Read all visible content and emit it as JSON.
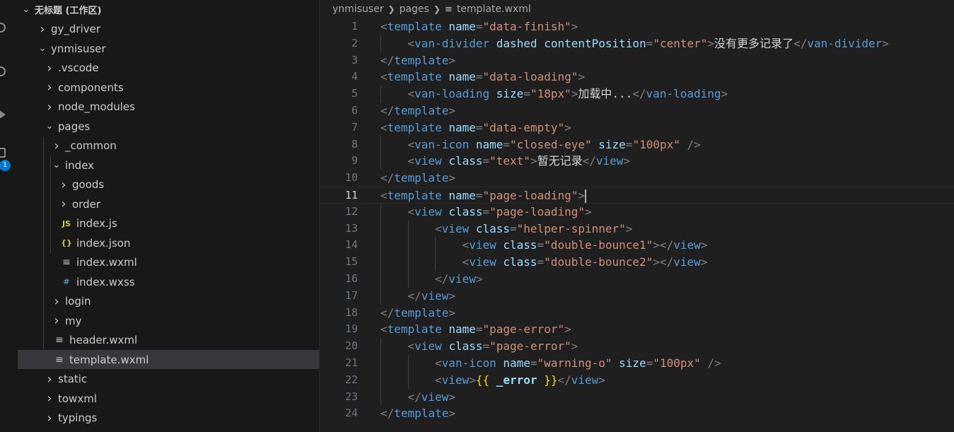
{
  "explorer": {
    "workspace_title": "无标题 (工作区)",
    "items": [
      {
        "label": "gy_driver",
        "kind": "folder",
        "expanded": false,
        "depth": 1
      },
      {
        "label": "ynmisuser",
        "kind": "folder",
        "expanded": true,
        "depth": 1
      },
      {
        "label": ".vscode",
        "kind": "folder",
        "expanded": false,
        "depth": 2
      },
      {
        "label": "components",
        "kind": "folder",
        "expanded": false,
        "depth": 2
      },
      {
        "label": "node_modules",
        "kind": "folder",
        "expanded": false,
        "depth": 2
      },
      {
        "label": "pages",
        "kind": "folder",
        "expanded": true,
        "depth": 2
      },
      {
        "label": "_common",
        "kind": "folder",
        "expanded": false,
        "depth": 3
      },
      {
        "label": "index",
        "kind": "folder",
        "expanded": true,
        "depth": 3
      },
      {
        "label": "goods",
        "kind": "folder",
        "expanded": false,
        "depth": 4
      },
      {
        "label": "order",
        "kind": "folder",
        "expanded": false,
        "depth": 4
      },
      {
        "label": "index.js",
        "kind": "file",
        "icon": "JS",
        "icon_color": "#cbcb41",
        "depth": 4
      },
      {
        "label": "index.json",
        "kind": "file",
        "icon": "{}",
        "icon_color": "#cbcb41",
        "depth": 4
      },
      {
        "label": "index.wxml",
        "kind": "file",
        "icon": "≡",
        "icon_color": "#c5c5c5",
        "depth": 4
      },
      {
        "label": "index.wxss",
        "kind": "file",
        "icon": "#",
        "icon_color": "#519aba",
        "depth": 4
      },
      {
        "label": "login",
        "kind": "folder",
        "expanded": false,
        "depth": 3
      },
      {
        "label": "my",
        "kind": "folder",
        "expanded": false,
        "depth": 3
      },
      {
        "label": "header.wxml",
        "kind": "file",
        "icon": "≡",
        "icon_color": "#c5c5c5",
        "depth": 3
      },
      {
        "label": "template.wxml",
        "kind": "file",
        "icon": "≡",
        "icon_color": "#c5c5c5",
        "depth": 3,
        "selected": true
      },
      {
        "label": "static",
        "kind": "folder",
        "expanded": false,
        "depth": 2
      },
      {
        "label": "towxml",
        "kind": "folder",
        "expanded": false,
        "depth": 2
      },
      {
        "label": "typings",
        "kind": "folder",
        "expanded": false,
        "depth": 2
      }
    ]
  },
  "activity_bar": {
    "badge_count": "1",
    "icons": [
      "search-icon",
      "source-control-icon",
      "run-debug-icon",
      "extensions-icon"
    ]
  },
  "breadcrumb": {
    "parts": [
      "ynmisuser",
      "pages",
      "template.wxml"
    ]
  },
  "editor": {
    "current_line": 11,
    "lines": [
      {
        "n": "1",
        "indent": 0,
        "tokens": [
          [
            "p",
            "<"
          ],
          [
            "t",
            "template"
          ],
          [
            "s",
            " "
          ],
          [
            "a",
            "name"
          ],
          [
            "p",
            "="
          ],
          [
            "v",
            "\"data-finish\""
          ],
          [
            "p",
            ">"
          ]
        ]
      },
      {
        "n": "2",
        "indent": 1,
        "tokens": [
          [
            "p",
            "<"
          ],
          [
            "t",
            "van-divider"
          ],
          [
            "s",
            " "
          ],
          [
            "a",
            "dashed"
          ],
          [
            "s",
            " "
          ],
          [
            "a",
            "contentPosition"
          ],
          [
            "p",
            "="
          ],
          [
            "v",
            "\"center\""
          ],
          [
            "p",
            ">"
          ],
          [
            "x",
            "没有更多记录了"
          ],
          [
            "p",
            "</"
          ],
          [
            "t",
            "van-divider"
          ],
          [
            "p",
            ">"
          ]
        ]
      },
      {
        "n": "3",
        "indent": 0,
        "tokens": [
          [
            "p",
            "</"
          ],
          [
            "t",
            "template"
          ],
          [
            "p",
            ">"
          ]
        ]
      },
      {
        "n": "4",
        "indent": 0,
        "tokens": [
          [
            "p",
            "<"
          ],
          [
            "t",
            "template"
          ],
          [
            "s",
            " "
          ],
          [
            "a",
            "name"
          ],
          [
            "p",
            "="
          ],
          [
            "v",
            "\"data-loading\""
          ],
          [
            "p",
            ">"
          ]
        ]
      },
      {
        "n": "5",
        "indent": 1,
        "tokens": [
          [
            "p",
            "<"
          ],
          [
            "t",
            "van-loading"
          ],
          [
            "s",
            " "
          ],
          [
            "a",
            "size"
          ],
          [
            "p",
            "="
          ],
          [
            "v",
            "\"18px\""
          ],
          [
            "p",
            ">"
          ],
          [
            "x",
            "加载中..."
          ],
          [
            "p",
            "</"
          ],
          [
            "t",
            "van-loading"
          ],
          [
            "p",
            ">"
          ]
        ]
      },
      {
        "n": "6",
        "indent": 0,
        "tokens": [
          [
            "p",
            "</"
          ],
          [
            "t",
            "template"
          ],
          [
            "p",
            ">"
          ]
        ]
      },
      {
        "n": "7",
        "indent": 0,
        "tokens": [
          [
            "p",
            "<"
          ],
          [
            "t",
            "template"
          ],
          [
            "s",
            " "
          ],
          [
            "a",
            "name"
          ],
          [
            "p",
            "="
          ],
          [
            "v",
            "\"data-empty\""
          ],
          [
            "p",
            ">"
          ]
        ]
      },
      {
        "n": "8",
        "indent": 1,
        "tokens": [
          [
            "p",
            "<"
          ],
          [
            "t",
            "van-icon"
          ],
          [
            "s",
            " "
          ],
          [
            "a",
            "name"
          ],
          [
            "p",
            "="
          ],
          [
            "v",
            "\"closed-eye\""
          ],
          [
            "s",
            " "
          ],
          [
            "a",
            "size"
          ],
          [
            "p",
            "="
          ],
          [
            "v",
            "\"100px\""
          ],
          [
            "s",
            " "
          ],
          [
            "p",
            "/>"
          ]
        ]
      },
      {
        "n": "9",
        "indent": 1,
        "tokens": [
          [
            "p",
            "<"
          ],
          [
            "t",
            "view"
          ],
          [
            "s",
            " "
          ],
          [
            "a",
            "class"
          ],
          [
            "p",
            "="
          ],
          [
            "v",
            "\"text\""
          ],
          [
            "p",
            ">"
          ],
          [
            "x",
            "暂无记录"
          ],
          [
            "p",
            "</"
          ],
          [
            "t",
            "view"
          ],
          [
            "p",
            ">"
          ]
        ]
      },
      {
        "n": "10",
        "indent": 0,
        "tokens": [
          [
            "p",
            "</"
          ],
          [
            "t",
            "template"
          ],
          [
            "p",
            ">"
          ]
        ]
      },
      {
        "n": "11",
        "indent": 0,
        "tokens": [
          [
            "p",
            "<"
          ],
          [
            "t",
            "template"
          ],
          [
            "s",
            " "
          ],
          [
            "a",
            "name"
          ],
          [
            "p",
            "="
          ],
          [
            "v",
            "\"page-loading\""
          ],
          [
            "p",
            ">"
          ]
        ]
      },
      {
        "n": "12",
        "indent": 1,
        "tokens": [
          [
            "p",
            "<"
          ],
          [
            "t",
            "view"
          ],
          [
            "s",
            " "
          ],
          [
            "a",
            "class"
          ],
          [
            "p",
            "="
          ],
          [
            "v",
            "\"page-loading\""
          ],
          [
            "p",
            ">"
          ]
        ]
      },
      {
        "n": "13",
        "indent": 2,
        "tokens": [
          [
            "p",
            "<"
          ],
          [
            "t",
            "view"
          ],
          [
            "s",
            " "
          ],
          [
            "a",
            "class"
          ],
          [
            "p",
            "="
          ],
          [
            "v",
            "\"helper-spinner\""
          ],
          [
            "p",
            ">"
          ]
        ]
      },
      {
        "n": "14",
        "indent": 3,
        "tokens": [
          [
            "p",
            "<"
          ],
          [
            "t",
            "view"
          ],
          [
            "s",
            " "
          ],
          [
            "a",
            "class"
          ],
          [
            "p",
            "="
          ],
          [
            "v",
            "\"double-bounce1\""
          ],
          [
            "p",
            "></"
          ],
          [
            "t",
            "view"
          ],
          [
            "p",
            ">"
          ]
        ]
      },
      {
        "n": "15",
        "indent": 3,
        "tokens": [
          [
            "p",
            "<"
          ],
          [
            "t",
            "view"
          ],
          [
            "s",
            " "
          ],
          [
            "a",
            "class"
          ],
          [
            "p",
            "="
          ],
          [
            "v",
            "\"double-bounce2\""
          ],
          [
            "p",
            "></"
          ],
          [
            "t",
            "view"
          ],
          [
            "p",
            ">"
          ]
        ]
      },
      {
        "n": "16",
        "indent": 2,
        "tokens": [
          [
            "p",
            "</"
          ],
          [
            "t",
            "view"
          ],
          [
            "p",
            ">"
          ]
        ]
      },
      {
        "n": "17",
        "indent": 1,
        "tokens": [
          [
            "p",
            "</"
          ],
          [
            "t",
            "view"
          ],
          [
            "p",
            ">"
          ]
        ]
      },
      {
        "n": "18",
        "indent": 0,
        "tokens": [
          [
            "p",
            "</"
          ],
          [
            "t",
            "template"
          ],
          [
            "p",
            ">"
          ]
        ]
      },
      {
        "n": "19",
        "indent": 0,
        "tokens": [
          [
            "p",
            "<"
          ],
          [
            "t",
            "template"
          ],
          [
            "s",
            " "
          ],
          [
            "a",
            "name"
          ],
          [
            "p",
            "="
          ],
          [
            "v",
            "\"page-error\""
          ],
          [
            "p",
            ">"
          ]
        ]
      },
      {
        "n": "20",
        "indent": 1,
        "tokens": [
          [
            "p",
            "<"
          ],
          [
            "t",
            "view"
          ],
          [
            "s",
            " "
          ],
          [
            "a",
            "class"
          ],
          [
            "p",
            "="
          ],
          [
            "v",
            "\"page-error\""
          ],
          [
            "p",
            ">"
          ]
        ]
      },
      {
        "n": "21",
        "indent": 2,
        "tokens": [
          [
            "p",
            "<"
          ],
          [
            "t",
            "van-icon"
          ],
          [
            "s",
            " "
          ],
          [
            "a",
            "name"
          ],
          [
            "p",
            "="
          ],
          [
            "v",
            "\"warning-o\""
          ],
          [
            "s",
            " "
          ],
          [
            "a",
            "size"
          ],
          [
            "p",
            "="
          ],
          [
            "v",
            "\"100px\""
          ],
          [
            "s",
            " "
          ],
          [
            "p",
            "/>"
          ]
        ]
      },
      {
        "n": "22",
        "indent": 2,
        "tokens": [
          [
            "p",
            "<"
          ],
          [
            "t",
            "view"
          ],
          [
            "p",
            ">"
          ],
          [
            "b",
            "{{"
          ],
          [
            "s",
            " "
          ],
          [
            "r",
            "_error"
          ],
          [
            "s",
            " "
          ],
          [
            "b",
            "}}"
          ],
          [
            "p",
            "</"
          ],
          [
            "t",
            "view"
          ],
          [
            "p",
            ">"
          ]
        ]
      },
      {
        "n": "23",
        "indent": 1,
        "tokens": [
          [
            "p",
            "</"
          ],
          [
            "t",
            "view"
          ],
          [
            "p",
            ">"
          ]
        ]
      },
      {
        "n": "24",
        "indent": 0,
        "tokens": [
          [
            "p",
            "</"
          ],
          [
            "t",
            "template"
          ],
          [
            "p",
            ">"
          ]
        ]
      }
    ]
  }
}
